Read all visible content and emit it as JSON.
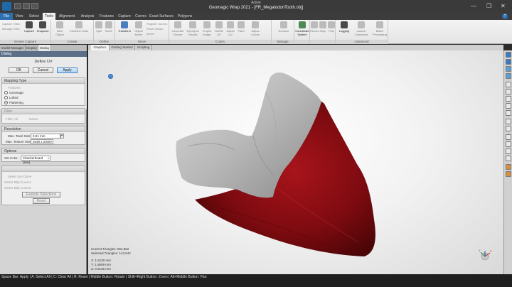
{
  "window": {
    "active_label": "Active",
    "title": "Geomagic Wrap 2021 - [FR_MegalodonTooth.obj]",
    "controls": [
      "—",
      "❐",
      "✕"
    ]
  },
  "ribbon_tabs": [
    "File",
    "View",
    "Select",
    "Tools",
    "Alignment",
    "Analysis",
    "Features",
    "Capture",
    "Curves",
    "Exact Surfaces",
    "Polygons"
  ],
  "ribbon": {
    "groups": [
      {
        "name": "Screen Capture",
        "buttons": [
          "Capture",
          "Snapshot"
        ],
        "small": [
          "Capture Video",
          "Manage DWK"
        ]
      },
      {
        "name": "Create",
        "buttons": [
          "New Object",
          "Combine Scan"
        ],
        "small": [
          "Object Space"
        ]
      },
      {
        "name": "Define",
        "buttons": [
          "Split",
          "Move"
        ],
        "small": []
      },
      {
        "name": "Move",
        "buttons": [
          "Transform",
          "Object Mover"
        ],
        "small": [
          "Register Scenes",
          "Reset Viewer",
          "Move+"
        ]
      },
      {
        "name": "Colors",
        "buttons": [
          "Generate Texture",
          "Reproject Texture",
          "Project Image",
          "Define UV",
          "Adjust UV",
          "Paint",
          "Adjust Colors"
        ],
        "small": []
      },
      {
        "name": "Manage",
        "buttons": [
          "Remove",
          "Coordinate System"
        ],
        "small": []
      },
      {
        "name": "",
        "buttons": [
          "Record",
          "Stop",
          "Play"
        ],
        "small": []
      },
      {
        "name": "Advanced",
        "buttons": [
          "Logging",
          "Launch Command",
          "Batch Processing"
        ],
        "small": []
      }
    ]
  },
  "panel": {
    "tabs": [
      "Model Manager",
      "Display",
      "Dialog"
    ],
    "dialog_bar": "Dialog",
    "title": "Define UV",
    "buttons": {
      "ok": "OK",
      "cancel": "Cancel",
      "apply": "Apply"
    },
    "mapping": {
      "header": "Mapping Type",
      "label": "Features",
      "options": [
        "Geomagic",
        "Lofted",
        "Flattening"
      ],
      "selected": "Flattening"
    },
    "filter": {
      "header": "Filter",
      "filter_label": "Filter:",
      "filter_value": "All",
      "name_label": "Name:"
    },
    "resolution": {
      "header": "Resolution",
      "texel_label": "Max. Texel Size:",
      "texel_value": "0.01 mm",
      "texture_label": "Max. Texture Size:",
      "texture_value": "2048 x 2048"
    },
    "options": {
      "header": "Options",
      "color_label": "Set Color:",
      "color_value": "Checkerboard (6x6)"
    },
    "curves": {
      "rows": [
        "Select Iso-Curve",
        "Select Bdy-Curve1",
        "Select Bdy-Curve2"
      ],
      "explode": "Explode Selections",
      "reset": "Reset"
    }
  },
  "viewport": {
    "tabs": [
      "Graphics",
      "Getting Started",
      "Scripting"
    ],
    "current_triangles_label": "Current Triangles:",
    "current_triangles": "554,852",
    "selected_triangles_label": "Selected Triangles:",
    "selected_triangles": "142,042",
    "coords": {
      "x": "1.5130 mm",
      "y": "1.5609 mm",
      "z": "0.0135 mm"
    },
    "colors": {
      "enamel": "#cfcfcf",
      "root_selected": "#8b0d12"
    }
  },
  "status_bar": "Space Bar: Apply | A: Select All | C: Clear All | R: Reset | Middle Button: Rotate | Shift+Right Button: Zoom | Alt+Middle Button: Pan"
}
